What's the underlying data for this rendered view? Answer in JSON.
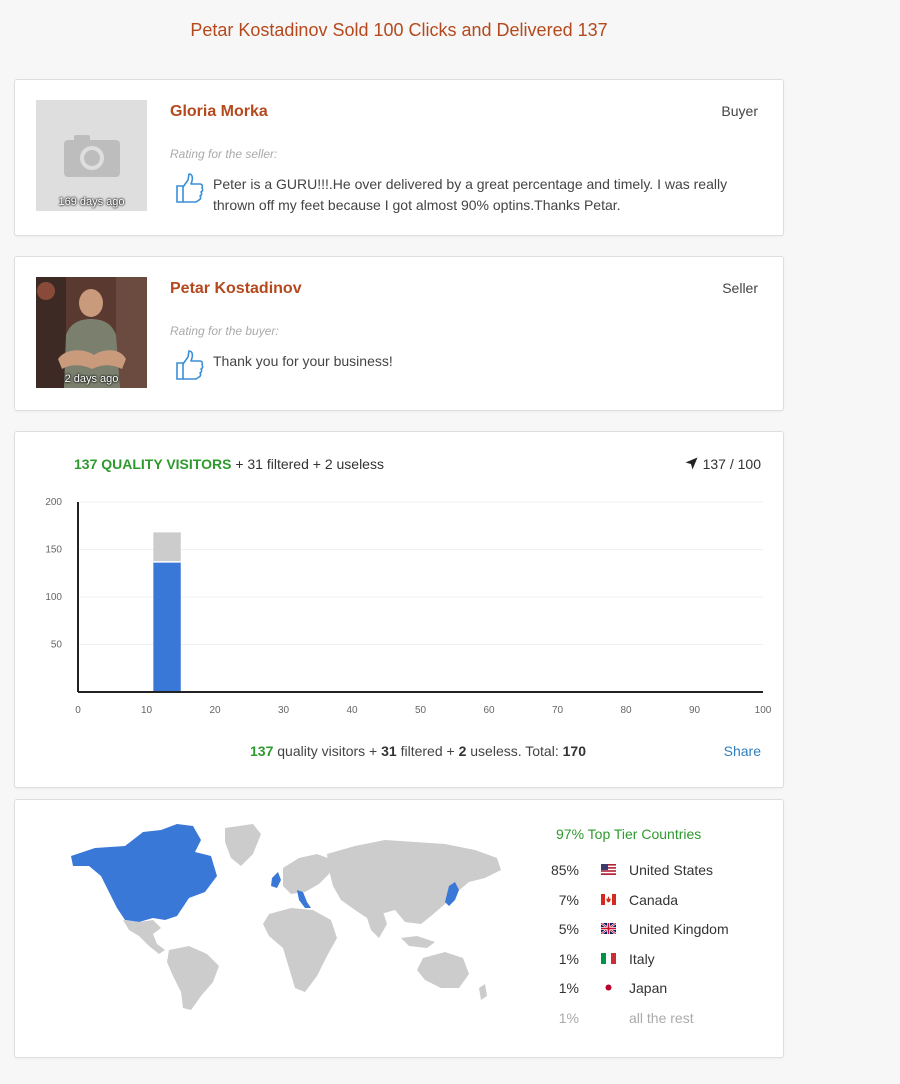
{
  "page_title": "Petar Kostadinov Sold 100 Clicks and Delivered 137",
  "reviews": [
    {
      "name": "Gloria Morka",
      "role": "Buyer",
      "time_ago": "169 days ago",
      "rating_label": "Rating for the seller:",
      "comment": "Peter is a GURU!!!.He over delivered by a great percentage and timely. I was really thrown off my feet because I got almost 90% optins.Thanks Petar."
    },
    {
      "name": "Petar Kostadinov",
      "role": "Seller",
      "time_ago": "2 days ago",
      "rating_label": "Rating for the buyer:",
      "comment": "Thank you for your business!"
    }
  ],
  "stats": {
    "quality_label": "137 QUALITY VISITORS",
    "extra_label": "+ 31 filtered + 2 useless",
    "progress": "137 / 100",
    "summary": {
      "quality": "137",
      "quality_text": "quality visitors +",
      "filtered": "31",
      "filtered_text": "filtered +",
      "useless": "2",
      "useless_text": "useless. Total:",
      "total": "170"
    },
    "share_label": "Share"
  },
  "chart_data": {
    "type": "bar",
    "x_ticks": [
      0,
      10,
      20,
      30,
      40,
      50,
      60,
      70,
      80,
      90,
      100
    ],
    "y_ticks": [
      50,
      100,
      150,
      200
    ],
    "xlim": [
      0,
      100
    ],
    "ylim": [
      0,
      200
    ],
    "stacked": true,
    "bar_x_range": [
      11,
      15
    ],
    "series": [
      {
        "values": [
          137
        ],
        "color": "#3a78d8"
      },
      {
        "values": [
          31
        ],
        "color": "#cccccc"
      }
    ]
  },
  "geo": {
    "tier_title": "97% Top Tier Countries",
    "countries": [
      {
        "pct": "85%",
        "name": "United States",
        "flag": "us-flag"
      },
      {
        "pct": "7%",
        "name": "Canada",
        "flag": "ca-flag"
      },
      {
        "pct": "5%",
        "name": "United Kingdom",
        "flag": "uk-flag"
      },
      {
        "pct": "1%",
        "name": "Italy",
        "flag": "it-flag"
      },
      {
        "pct": "1%",
        "name": "Japan",
        "flag": "jp-flag"
      },
      {
        "pct": "1%",
        "name": "all the rest",
        "flag": ""
      }
    ],
    "highlight_color": "#3a78d8",
    "base_color": "#cccccc"
  }
}
